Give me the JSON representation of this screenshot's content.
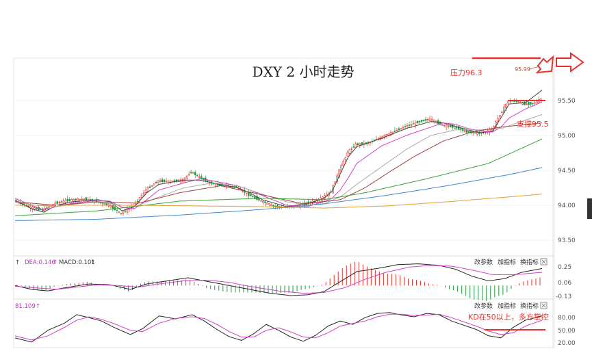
{
  "chart_data": {
    "type": "candlestick",
    "title": "DXY 2 小时走势",
    "price_axis": {
      "ticks": [
        "95.50",
        "95.00",
        "94.50",
        "94.00",
        "93.50"
      ],
      "ylim": [
        93.3,
        96.1
      ]
    },
    "price_marker": "95.99",
    "annotations": {
      "resistance": {
        "label": "压力96.3",
        "value": 96.3
      },
      "support": {
        "label": "支撑95.5",
        "value": 95.5
      },
      "kd_note": "KD在50以上，多方掌控"
    },
    "price_knots": [
      [
        0,
        94.07
      ],
      [
        8,
        93.97
      ],
      [
        14,
        93.93
      ],
      [
        20,
        94.03
      ],
      [
        26,
        94.07
      ],
      [
        34,
        94.09
      ],
      [
        40,
        94.05
      ],
      [
        46,
        94.0
      ],
      [
        52,
        93.88
      ],
      [
        58,
        94.0
      ],
      [
        64,
        94.22
      ],
      [
        70,
        94.35
      ],
      [
        76,
        94.34
      ],
      [
        82,
        94.36
      ],
      [
        86,
        94.48
      ],
      [
        90,
        94.4
      ],
      [
        96,
        94.31
      ],
      [
        102,
        94.28
      ],
      [
        108,
        94.26
      ],
      [
        114,
        94.15
      ],
      [
        120,
        94.06
      ],
      [
        126,
        93.99
      ],
      [
        132,
        93.97
      ],
      [
        138,
        93.99
      ],
      [
        142,
        94.03
      ],
      [
        148,
        94.07
      ],
      [
        154,
        94.2
      ],
      [
        158,
        94.5
      ],
      [
        162,
        94.76
      ],
      [
        166,
        94.87
      ],
      [
        172,
        94.89
      ],
      [
        178,
        94.97
      ],
      [
        184,
        95.05
      ],
      [
        190,
        95.13
      ],
      [
        196,
        95.19
      ],
      [
        202,
        95.24
      ],
      [
        208,
        95.15
      ],
      [
        214,
        95.12
      ],
      [
        220,
        95.05
      ],
      [
        226,
        95.03
      ],
      [
        232,
        95.08
      ],
      [
        236,
        95.3
      ],
      [
        240,
        95.5
      ],
      [
        244,
        95.49
      ],
      [
        248,
        95.45
      ],
      [
        252,
        95.46
      ],
      [
        256,
        95.52
      ]
    ],
    "ma_lines": [
      {
        "color": "#444444",
        "knots": [
          [
            0,
            94.07
          ],
          [
            8,
            93.95
          ],
          [
            14,
            93.9
          ],
          [
            20,
            94.0
          ],
          [
            28,
            94.05
          ],
          [
            40,
            94.08
          ],
          [
            46,
            94.05
          ],
          [
            52,
            93.92
          ],
          [
            58,
            93.98
          ],
          [
            64,
            94.18
          ],
          [
            70,
            94.3
          ],
          [
            82,
            94.36
          ],
          [
            90,
            94.36
          ],
          [
            96,
            94.32
          ],
          [
            108,
            94.25
          ],
          [
            114,
            94.18
          ],
          [
            120,
            94.08
          ],
          [
            132,
            93.98
          ],
          [
            142,
            94.02
          ],
          [
            150,
            94.1
          ],
          [
            154,
            94.2
          ],
          [
            158,
            94.45
          ],
          [
            162,
            94.7
          ],
          [
            166,
            94.84
          ],
          [
            178,
            94.96
          ],
          [
            190,
            95.1
          ],
          [
            202,
            95.2
          ],
          [
            208,
            95.18
          ],
          [
            214,
            95.13
          ],
          [
            220,
            95.08
          ],
          [
            226,
            95.04
          ],
          [
            232,
            95.06
          ],
          [
            236,
            95.25
          ],
          [
            240,
            95.45
          ],
          [
            248,
            95.47
          ],
          [
            256,
            95.65
          ]
        ]
      },
      {
        "color": "#d040c8",
        "knots": [
          [
            0,
            94.1
          ],
          [
            8,
            94.0
          ],
          [
            14,
            93.93
          ],
          [
            20,
            93.98
          ],
          [
            28,
            94.03
          ],
          [
            40,
            94.07
          ],
          [
            46,
            94.06
          ],
          [
            52,
            93.97
          ],
          [
            58,
            93.95
          ],
          [
            64,
            94.08
          ],
          [
            70,
            94.22
          ],
          [
            82,
            94.32
          ],
          [
            90,
            94.38
          ],
          [
            96,
            94.35
          ],
          [
            108,
            94.28
          ],
          [
            114,
            94.22
          ],
          [
            120,
            94.14
          ],
          [
            132,
            94.0
          ],
          [
            142,
            93.98
          ],
          [
            150,
            94.05
          ],
          [
            154,
            94.1
          ],
          [
            158,
            94.22
          ],
          [
            162,
            94.4
          ],
          [
            166,
            94.6
          ],
          [
            178,
            94.85
          ],
          [
            190,
            95.0
          ],
          [
            202,
            95.12
          ],
          [
            208,
            95.18
          ],
          [
            214,
            95.16
          ],
          [
            220,
            95.1
          ],
          [
            226,
            95.06
          ],
          [
            232,
            95.05
          ],
          [
            236,
            95.12
          ],
          [
            240,
            95.25
          ],
          [
            248,
            95.38
          ],
          [
            256,
            95.48
          ]
        ]
      },
      {
        "color": "#aaaaaa",
        "knots": [
          [
            0,
            94.05
          ],
          [
            10,
            94.0
          ],
          [
            20,
            93.98
          ],
          [
            30,
            94.02
          ],
          [
            40,
            94.05
          ],
          [
            52,
            94.0
          ],
          [
            60,
            94.0
          ],
          [
            70,
            94.12
          ],
          [
            82,
            94.25
          ],
          [
            96,
            94.32
          ],
          [
            108,
            94.28
          ],
          [
            120,
            94.16
          ],
          [
            132,
            94.05
          ],
          [
            142,
            94.0
          ],
          [
            150,
            94.02
          ],
          [
            158,
            94.12
          ],
          [
            166,
            94.3
          ],
          [
            178,
            94.55
          ],
          [
            190,
            94.8
          ],
          [
            202,
            95.0
          ],
          [
            214,
            95.08
          ],
          [
            226,
            95.08
          ],
          [
            236,
            95.1
          ],
          [
            248,
            95.22
          ],
          [
            256,
            95.3
          ]
        ]
      },
      {
        "color": "#a04040",
        "knots": [
          [
            0,
            94.05
          ],
          [
            20,
            94.0
          ],
          [
            40,
            94.05
          ],
          [
            60,
            94.03
          ],
          [
            80,
            94.18
          ],
          [
            100,
            94.28
          ],
          [
            120,
            94.15
          ],
          [
            140,
            94.02
          ],
          [
            158,
            94.08
          ],
          [
            170,
            94.25
          ],
          [
            182,
            94.48
          ],
          [
            194,
            94.7
          ],
          [
            208,
            94.92
          ],
          [
            222,
            95.05
          ],
          [
            236,
            95.12
          ],
          [
            256,
            95.18
          ]
        ]
      },
      {
        "color": "#38a038",
        "knots": [
          [
            0,
            93.85
          ],
          [
            40,
            93.92
          ],
          [
            80,
            94.06
          ],
          [
            120,
            94.1
          ],
          [
            150,
            94.08
          ],
          [
            170,
            94.18
          ],
          [
            200,
            94.38
          ],
          [
            230,
            94.6
          ],
          [
            256,
            94.95
          ]
        ]
      },
      {
        "color": "#3a88d0",
        "knots": [
          [
            0,
            93.78
          ],
          [
            40,
            93.8
          ],
          [
            80,
            93.86
          ],
          [
            120,
            93.94
          ],
          [
            150,
            94.02
          ],
          [
            180,
            94.14
          ],
          [
            210,
            94.28
          ],
          [
            240,
            94.44
          ],
          [
            256,
            94.54
          ]
        ]
      },
      {
        "color": "#e0a030",
        "knots": [
          [
            0,
            94.0
          ],
          [
            60,
            94.0
          ],
          [
            120,
            93.98
          ],
          [
            150,
            93.96
          ],
          [
            180,
            93.99
          ],
          [
            210,
            94.05
          ],
          [
            240,
            94.12
          ],
          [
            256,
            94.16
          ]
        ]
      }
    ],
    "macd": {
      "labels": {
        "dea": "DEA:0.146",
        "macd": "MACD:0.101"
      },
      "ticks": [
        "0.25",
        "0.06",
        "-0.13"
      ],
      "ylim": [
        -0.16,
        0.32
      ],
      "dif_knots": [
        [
          0,
          0.0
        ],
        [
          8,
          -0.05
        ],
        [
          16,
          -0.07
        ],
        [
          24,
          -0.03
        ],
        [
          36,
          0.02
        ],
        [
          46,
          0.01
        ],
        [
          56,
          -0.05
        ],
        [
          64,
          0.02
        ],
        [
          74,
          0.06
        ],
        [
          84,
          0.1
        ],
        [
          92,
          0.06
        ],
        [
          100,
          0.02
        ],
        [
          112,
          -0.04
        ],
        [
          124,
          -0.1
        ],
        [
          134,
          -0.13
        ],
        [
          142,
          -0.12
        ],
        [
          150,
          -0.08
        ],
        [
          158,
          0.05
        ],
        [
          166,
          0.18
        ],
        [
          176,
          0.22
        ],
        [
          186,
          0.27
        ],
        [
          196,
          0.28
        ],
        [
          206,
          0.26
        ],
        [
          214,
          0.21
        ],
        [
          222,
          0.12
        ],
        [
          230,
          0.06
        ],
        [
          238,
          0.09
        ],
        [
          246,
          0.17
        ],
        [
          256,
          0.22
        ]
      ],
      "dea_knots": [
        [
          0,
          -0.01
        ],
        [
          10,
          -0.03
        ],
        [
          20,
          -0.05
        ],
        [
          30,
          -0.02
        ],
        [
          40,
          0.01
        ],
        [
          50,
          0.0
        ],
        [
          60,
          -0.02
        ],
        [
          70,
          0.02
        ],
        [
          82,
          0.06
        ],
        [
          94,
          0.07
        ],
        [
          104,
          0.04
        ],
        [
          116,
          -0.02
        ],
        [
          128,
          -0.07
        ],
        [
          140,
          -0.1
        ],
        [
          150,
          -0.09
        ],
        [
          160,
          -0.03
        ],
        [
          170,
          0.08
        ],
        [
          180,
          0.17
        ],
        [
          192,
          0.24
        ],
        [
          202,
          0.26
        ],
        [
          212,
          0.25
        ],
        [
          222,
          0.2
        ],
        [
          232,
          0.14
        ],
        [
          242,
          0.14
        ],
        [
          256,
          0.17
        ]
      ]
    },
    "kd": {
      "label": "81.109",
      "ticks": [
        "80.00",
        "50.00",
        "20.00"
      ],
      "ylim": [
        10,
        100
      ],
      "k_knots": [
        [
          0,
          30
        ],
        [
          8,
          20
        ],
        [
          16,
          48
        ],
        [
          24,
          65
        ],
        [
          30,
          85
        ],
        [
          36,
          78
        ],
        [
          42,
          70
        ],
        [
          48,
          55
        ],
        [
          56,
          38
        ],
        [
          62,
          52
        ],
        [
          70,
          82
        ],
        [
          78,
          75
        ],
        [
          86,
          85
        ],
        [
          92,
          70
        ],
        [
          98,
          50
        ],
        [
          104,
          33
        ],
        [
          110,
          24
        ],
        [
          116,
          40
        ],
        [
          122,
          62
        ],
        [
          128,
          48
        ],
        [
          134,
          32
        ],
        [
          140,
          22
        ],
        [
          146,
          36
        ],
        [
          152,
          58
        ],
        [
          158,
          70
        ],
        [
          164,
          62
        ],
        [
          170,
          78
        ],
        [
          176,
          88
        ],
        [
          182,
          90
        ],
        [
          188,
          84
        ],
        [
          194,
          80
        ],
        [
          200,
          88
        ],
        [
          206,
          85
        ],
        [
          212,
          70
        ],
        [
          218,
          60
        ],
        [
          224,
          50
        ],
        [
          230,
          35
        ],
        [
          236,
          30
        ],
        [
          242,
          55
        ],
        [
          248,
          72
        ],
        [
          256,
          82
        ]
      ],
      "d_knots": [
        [
          0,
          35
        ],
        [
          8,
          25
        ],
        [
          16,
          35
        ],
        [
          24,
          55
        ],
        [
          30,
          72
        ],
        [
          36,
          80
        ],
        [
          42,
          74
        ],
        [
          48,
          64
        ],
        [
          56,
          48
        ],
        [
          62,
          45
        ],
        [
          70,
          65
        ],
        [
          78,
          76
        ],
        [
          86,
          80
        ],
        [
          92,
          76
        ],
        [
          98,
          62
        ],
        [
          104,
          45
        ],
        [
          110,
          32
        ],
        [
          116,
          32
        ],
        [
          122,
          48
        ],
        [
          128,
          54
        ],
        [
          134,
          44
        ],
        [
          140,
          32
        ],
        [
          146,
          30
        ],
        [
          152,
          42
        ],
        [
          158,
          58
        ],
        [
          164,
          64
        ],
        [
          170,
          70
        ],
        [
          176,
          80
        ],
        [
          182,
          86
        ],
        [
          188,
          86
        ],
        [
          194,
          83
        ],
        [
          200,
          84
        ],
        [
          206,
          86
        ],
        [
          212,
          78
        ],
        [
          218,
          68
        ],
        [
          224,
          58
        ],
        [
          230,
          46
        ],
        [
          236,
          38
        ],
        [
          242,
          42
        ],
        [
          248,
          58
        ],
        [
          256,
          72
        ]
      ]
    },
    "buttons": [
      "改参数",
      "加指标",
      "换指标"
    ]
  },
  "colors": {
    "up": "#e8312a",
    "down": "#1a9a3a",
    "annotation": "#e8312a"
  }
}
